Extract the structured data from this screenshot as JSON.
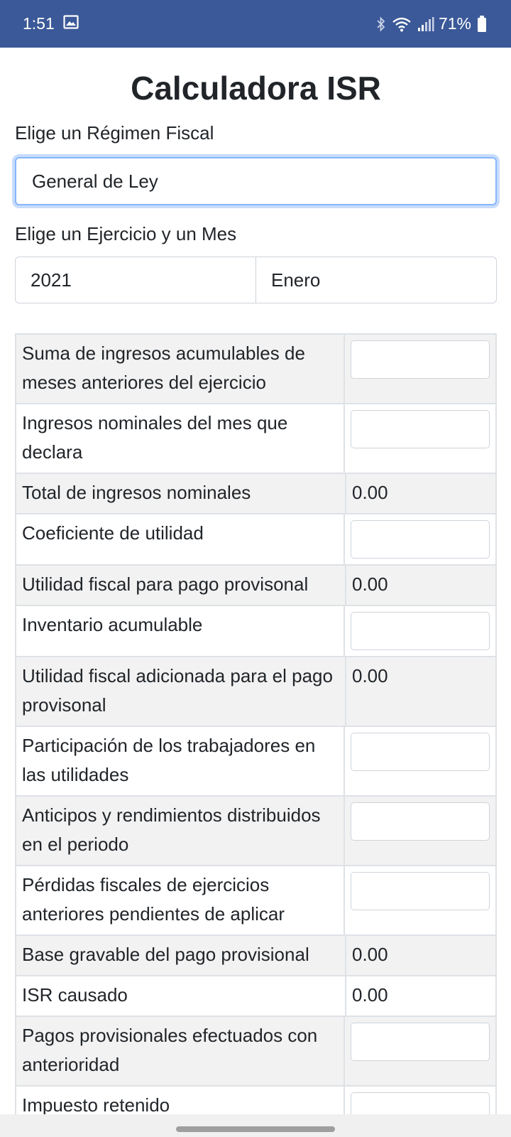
{
  "status_bar": {
    "time": "1:51",
    "battery": "71%",
    "icons": [
      "image-icon",
      "bluetooth-icon",
      "wifi-icon",
      "signal-icon",
      "battery-icon"
    ]
  },
  "app": {
    "title": "Calculadora ISR",
    "regime_label": "Elige un Régimen Fiscal",
    "regime_value": "General de Ley",
    "period_label": "Elige un Ejercicio y un Mes",
    "year_value": "2021",
    "month_value": "Enero"
  },
  "table": {
    "rows": [
      {
        "label": "Suma de ingresos acumulables de meses anteriores del ejercicio",
        "value": ""
      },
      {
        "label": "Ingresos nominales del mes que declara",
        "value": ""
      },
      {
        "label": "Total de ingresos nominales",
        "value": "0.00"
      },
      {
        "label": "Coeficiente de utilidad",
        "value": ""
      },
      {
        "label": "Utilidad fiscal para pago provisonal",
        "value": "0.00"
      },
      {
        "label": "Inventario acumulable",
        "value": ""
      },
      {
        "label": "Utilidad fiscal adicionada para el pago provisonal",
        "value": "0.00"
      },
      {
        "label": "Participación de los trabajadores en las utilidades",
        "value": ""
      },
      {
        "label": "Anticipos y rendimientos distribuidos en el periodo",
        "value": ""
      },
      {
        "label": "Pérdidas fiscales de ejercicios anteriores pendientes de aplicar",
        "value": ""
      },
      {
        "label": "Base gravable del pago provisional",
        "value": "0.00"
      },
      {
        "label": "ISR causado",
        "value": "0.00"
      },
      {
        "label": "Pagos provisionales efectuados con anterioridad",
        "value": ""
      },
      {
        "label": "Impuesto retenido",
        "value": ""
      }
    ]
  },
  "colors": {
    "status_bar": "#3b5998",
    "row_alt": "#f2f2f2",
    "focus_border": "#86b7fe"
  }
}
